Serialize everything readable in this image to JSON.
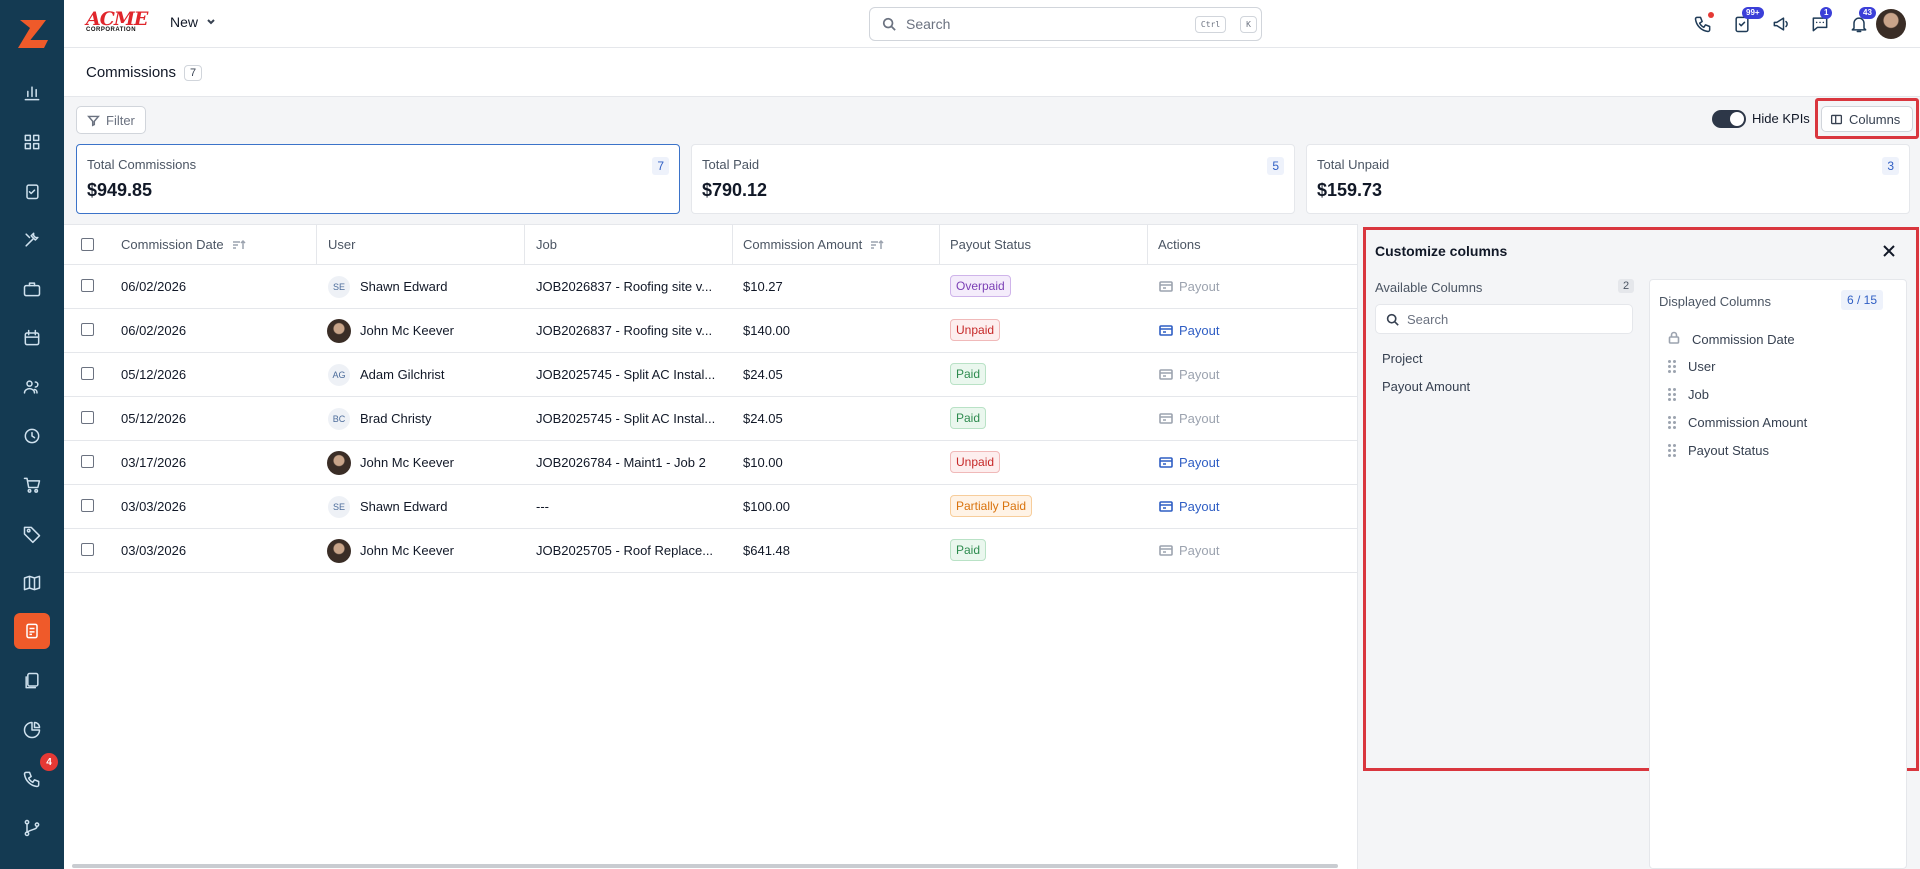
{
  "app": {
    "logo_text": "ACME",
    "logo_sub": "CORPORATION",
    "new_label": "New"
  },
  "search": {
    "placeholder": "Search",
    "kbd1": "Ctrl",
    "kbd2": "K"
  },
  "top_badges": {
    "tasks": "99+",
    "chat": "1",
    "notifications": "43"
  },
  "sidebar": {
    "badge": "4"
  },
  "page": {
    "title": "Commissions",
    "count": "7"
  },
  "toolbar": {
    "filter_label": "Filter",
    "hide_kpis_label": "Hide KPIs",
    "columns_label": "Columns"
  },
  "kpis": [
    {
      "label": "Total Commissions",
      "value": "$949.85",
      "count": "7"
    },
    {
      "label": "Total Paid",
      "value": "$790.12",
      "count": "5"
    },
    {
      "label": "Total Unpaid",
      "value": "$159.73",
      "count": "3"
    }
  ],
  "table": {
    "headers": [
      "Commission Date",
      "User",
      "Job",
      "Commission Amount",
      "Payout Status",
      "Actions"
    ],
    "rows": [
      {
        "date": "06/02/2026",
        "user": "Shawn Edward",
        "initials": "SE",
        "job": "JOB2026837 - Roofing site v...",
        "amount": "$10.27",
        "status": "Overpaid",
        "action": "Payout"
      },
      {
        "date": "06/02/2026",
        "user": "John Mc Keever",
        "initials": "",
        "job": "JOB2026837 - Roofing site v...",
        "amount": "$140.00",
        "status": "Unpaid",
        "action": "Payout"
      },
      {
        "date": "05/12/2026",
        "user": "Adam Gilchrist",
        "initials": "AG",
        "job": "JOB2025745 - Split AC Instal...",
        "amount": "$24.05",
        "status": "Paid",
        "action": "Payout"
      },
      {
        "date": "05/12/2026",
        "user": "Brad Christy",
        "initials": "BC",
        "job": "JOB2025745 - Split AC Instal...",
        "amount": "$24.05",
        "status": "Paid",
        "action": "Payout"
      },
      {
        "date": "03/17/2026",
        "user": "John Mc Keever",
        "initials": "",
        "job": "JOB2026784 - Maint1 - Job 2",
        "amount": "$10.00",
        "status": "Unpaid",
        "action": "Payout"
      },
      {
        "date": "03/03/2026",
        "user": "Shawn Edward",
        "initials": "SE",
        "job": "---",
        "amount": "$100.00",
        "status": "Partially Paid",
        "action": "Payout"
      },
      {
        "date": "03/03/2026",
        "user": "John Mc Keever",
        "initials": "",
        "job": "JOB2025705 - Roof Replace...",
        "amount": "$641.48",
        "status": "Paid",
        "action": "Payout"
      }
    ]
  },
  "customize": {
    "title": "Customize columns",
    "available_label": "Available Columns",
    "available_count": "2",
    "search_placeholder": "Search",
    "available": [
      "Project",
      "Payout Amount"
    ],
    "displayed_label": "Displayed Columns",
    "displayed_count": "6 / 15",
    "displayed": [
      "Commission Date",
      "User",
      "Job",
      "Commission Amount",
      "Payout Status"
    ]
  },
  "colors": {
    "sidebar": "#143a52",
    "accent": "#ef5a2a",
    "highlight": "#d9363e",
    "link": "#2f5ec4"
  }
}
